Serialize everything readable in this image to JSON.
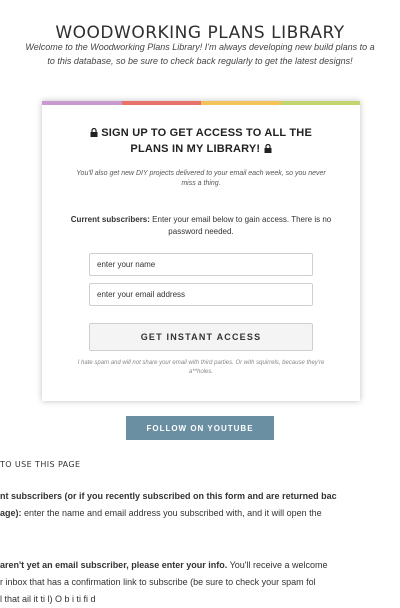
{
  "page": {
    "title": "WOODWORKING PLANS LIBRARY",
    "intro_line1": "Welcome to the Woodworking Plans Library! I'm always developing new build plans to a",
    "intro_line2": "to this database, so be sure to check back regularly to get the latest designs!"
  },
  "signup": {
    "stripe_colors": [
      "#c99ad0",
      "#e8736a",
      "#f2c35b",
      "#c3d56d"
    ],
    "heading_line1": "SIGN UP TO GET ACCESS TO ALL THE",
    "heading_line2": "PLANS IN MY LIBRARY!",
    "note": "You'll also get new DIY projects delivered to your email each week, so you never miss a thing.",
    "current_label": "Current subscribers:",
    "current_text": "Enter your email below to gain access. There is no password needed.",
    "name_placeholder": "enter your name",
    "email_placeholder": "enter your email address",
    "button_label": "GET INSTANT ACCESS",
    "disclaimer": "I hate spam and will not share your email with third parties. Or with squirrels, because they're a**holes."
  },
  "youtube_button": "FOLLOW ON YOUTUBE",
  "howto": {
    "heading": "TO USE THIS PAGE",
    "p1_line1_bold": "nt subscribers (or if you recently subscribed on this form and are returned bac",
    "p1_line2_bold": "age):",
    "p1_line2_rest": " enter the name and email address you subscribed with, and it will open the",
    "p2_line1_bold": "aren't yet an email subscriber, please enter your info.",
    "p2_line1_rest": " You'll receive a welcome",
    "p2_line2": "r inbox that has a confirmation link to subscribe (be sure to check your spam fol",
    "p2_line3": "l   that   ail it         ti   l)  O       b    i  ti          fi  d"
  }
}
